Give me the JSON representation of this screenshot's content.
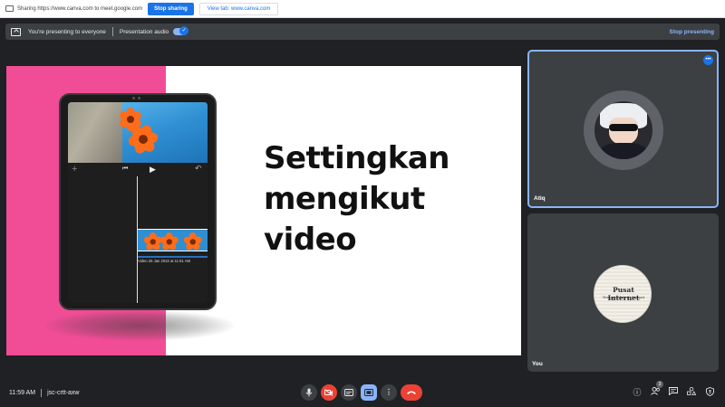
{
  "share_bar": {
    "sharing_text": "Sharing https://www.canva.com to meet.google.com",
    "stop_sharing": "Stop sharing",
    "view_tab": "View tab: www.canva.com"
  },
  "present_bar": {
    "presenting_text": "You're presenting to everyone",
    "audio_label": "Presentation audio",
    "audio_on": true,
    "stop_presenting": "Stop presenting"
  },
  "slide": {
    "headline": [
      "Settingkan",
      "mengikut",
      "video"
    ],
    "accent_color": "#f04d96",
    "tablet": {
      "clip_label": "Video 25 Jan 2022 at 11:51 AM"
    }
  },
  "participants": [
    {
      "name": "Atiq",
      "speaking": true,
      "avatar": "anime-character-avatar"
    },
    {
      "name": "You",
      "speaking": false,
      "avatar": "pusat-internet-logo-avatar",
      "logo_text": "Pusat Internet",
      "logo_subtext": "Tempat Aktiviti Rakyat"
    }
  ],
  "bottom_bar": {
    "time": "11:59 AM",
    "meeting_code": "jsc-crtt-axw",
    "people_count": "3",
    "controls": [
      "mic-icon",
      "camera-off-icon",
      "captions-icon",
      "present-icon",
      "more-options-icon",
      "hang-up-icon"
    ],
    "right_icons": [
      "info-icon",
      "people-icon",
      "chat-icon",
      "activities-icon",
      "host-controls-icon"
    ]
  },
  "colors": {
    "background": "#202124",
    "brand_blue": "#1a73e8",
    "danger_red": "#ea4335",
    "active_blue": "#8ab4f8"
  }
}
